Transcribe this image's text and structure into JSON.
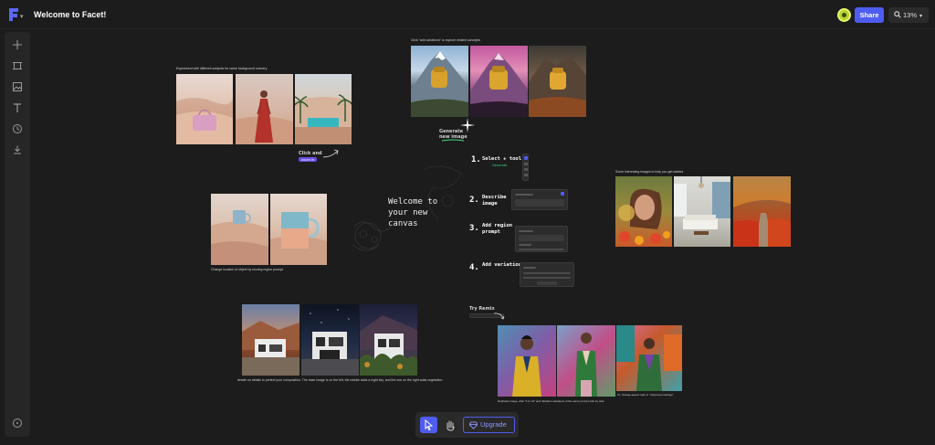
{
  "header": {
    "title": "Welcome to Facet!",
    "share_label": "Share",
    "zoom_label": "13%"
  },
  "sidebar": {
    "items": [
      {
        "name": "add-icon"
      },
      {
        "name": "frame-icon"
      },
      {
        "name": "image-icon"
      },
      {
        "name": "text-icon"
      },
      {
        "name": "history-icon"
      },
      {
        "name": "download-icon"
      }
    ],
    "help_icon": "help-icon"
  },
  "canvas": {
    "desert_caption": "Experiment with different subjects for same background scenery",
    "mountain_caption": "Click \"add variations\" to explore related concepts",
    "generate_label": "Generate\nnew image",
    "zoom_hint": "Click and",
    "zoom_hint_tag": "zoom in",
    "mug_caption": "Change location of object by moving region prompt",
    "welcome_text": "Welcome to\nyour new\ncanvas",
    "steps": [
      {
        "num": "1.",
        "label": "Select + tool",
        "sub": "Generate"
      },
      {
        "num": "2.",
        "label": "Describe\nimage"
      },
      {
        "num": "3.",
        "label": "Add region\nprompt"
      },
      {
        "num": "4.",
        "label": "Add variation"
      }
    ],
    "portrait_caption": "Some interesting images to help you get started",
    "house_caption": "Iterate on details to perfect your composition. The base image is on the left, the middle adds a night sky, and the one on the right adds vegetation",
    "try_remix": "Try Remix",
    "fashion_caption_left": "Duplicate image, click \"1x1 ref\" and Variation variations of the same prompt side by side",
    "fashion_caption_right": "Or, change aspect ratio in \"Advanced settings\""
  },
  "toolbar": {
    "upgrade_label": "Upgrade"
  },
  "colors": {
    "accent": "#4e5cf0",
    "background": "#1c1c1c",
    "panel": "#262626"
  }
}
